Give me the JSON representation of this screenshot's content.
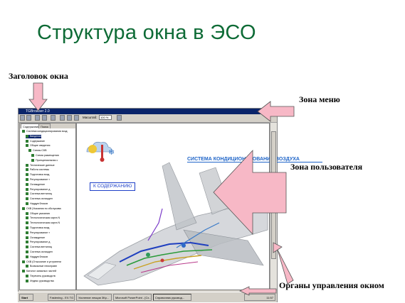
{
  "slide": {
    "title": "Структура окна в ЭСО",
    "labels": {
      "window_title": "Заголовок окна",
      "menu_zone": "Зона меню",
      "user_zone": "Зона пользователя",
      "window_controls": "Органы управления окном"
    }
  },
  "app": {
    "window_title": "TGBrowser 2.0",
    "toolbar": {
      "zoom_label": "Масштаб:",
      "zoom_value": "100 %"
    },
    "tabs": [
      "Содержание",
      "Поиск"
    ],
    "tree": [
      "Система кондиционирования возд",
      "Введение",
      "Содержание",
      "Общие сведения",
      "Схемы СКВ",
      "Схема размещения",
      "Принципиальная с",
      "Технические данные",
      "Работа системы",
      "Подготовка возд",
      "Регулирование т",
      "Охлаждение",
      "Регулирование д",
      "Система вентиляц",
      "Система охлажден",
      "Наддув блоков",
      "СКВ (Указания по обслужива",
      "Общие указания",
      "Технологическая карта N",
      "Технологическая карта N",
      "Подготовка возд",
      "Регулирование т",
      "Охлаждение",
      "Регулирование д",
      "Система вентиляц",
      "Система охлажден",
      "Наддув блоков",
      "СКВ (Отыскание и устранени",
      "Возможные неисправн",
      "Каталог запасных частей",
      "Перечень руководств",
      "Индекс руководства"
    ],
    "content": {
      "system_title": "СИСТЕМА КОНДИЦИОНИРОВАНИЯ ВОЗДУХА",
      "toc_button": "К СОДЕРЖАНИЮ"
    },
    "taskbar": {
      "start": "Start",
      "tasks": [
        "Fastening - ЕЧ TG Builders",
        "Усиление лекции 3Кр...",
        "Microsoft PowerPoint - [Сх...",
        "Справочник руковод..."
      ],
      "clock": "11:57"
    }
  },
  "colors": {
    "title_green": "#0e6b36",
    "arrow_pink": "#f7b8c6",
    "link_blue": "#1e64c8"
  }
}
